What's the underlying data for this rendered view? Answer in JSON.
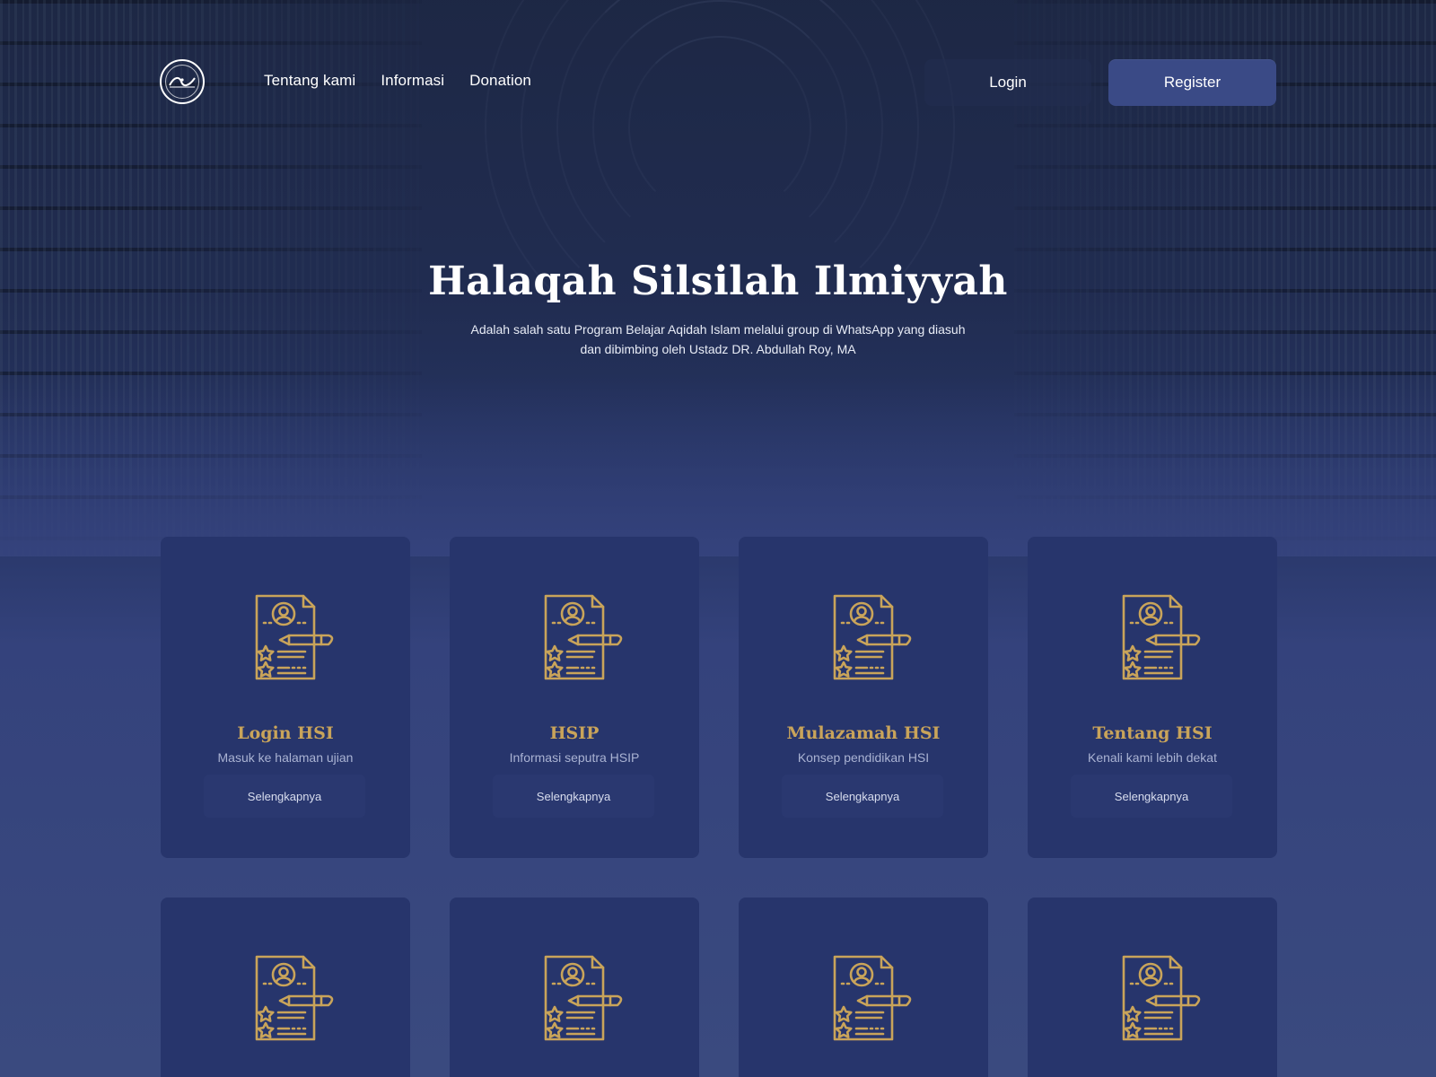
{
  "header": {
    "logo_icon": "hsi-logo-icon",
    "nav": [
      {
        "label": "Tentang kami"
      },
      {
        "label": "Informasi"
      },
      {
        "label": "Donation"
      }
    ],
    "login_label": "Login",
    "register_label": "Register"
  },
  "hero": {
    "title": "Halaqah Silsilah Ilmiyyah",
    "subtitle_line1": "Adalah salah satu Program Belajar Aqidah Islam melalui group di WhatsApp yang diasuh",
    "subtitle_line2": "dan dibimbing oleh Ustadz DR. Abdullah Roy, MA"
  },
  "cards": [
    {
      "icon": "resume-document-icon",
      "title": "Login HSI",
      "subtitle": "Masuk ke halaman ujian",
      "button": "Selengkapnya"
    },
    {
      "icon": "resume-document-icon",
      "title": "HSIP",
      "subtitle": "Informasi seputra HSIP",
      "button": "Selengkapnya"
    },
    {
      "icon": "resume-document-icon",
      "title": "Mulazamah HSI",
      "subtitle": "Konsep pendidikan HSI",
      "button": "Selengkapnya"
    },
    {
      "icon": "resume-document-icon",
      "title": "Tentang HSI",
      "subtitle": "Kenali kami lebih dekat",
      "button": "Selengkapnya"
    }
  ],
  "cards_row2": [
    {
      "icon": "resume-document-icon"
    },
    {
      "icon": "resume-document-icon"
    },
    {
      "icon": "resume-document-icon"
    },
    {
      "icon": "resume-document-icon"
    }
  ],
  "colors": {
    "card_bg": "#27356c",
    "accent_gold": "#c9a45a",
    "register_bg": "#3a4a86",
    "page_bg": "#3a4a7f"
  }
}
